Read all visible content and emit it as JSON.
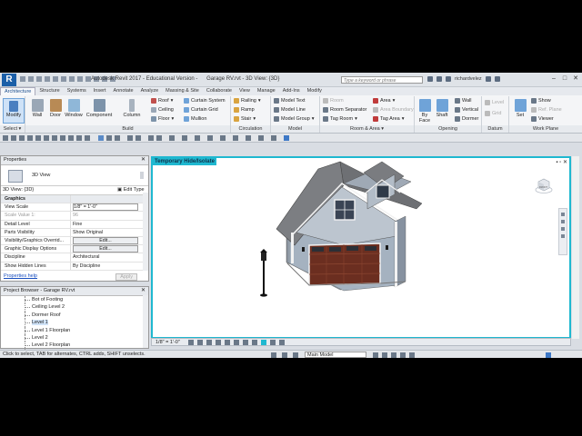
{
  "app": {
    "title_product": "Autodesk Revit 2017 - Educational Version -",
    "title_file": "Garage RV.rvt - 3D View: {3D}",
    "search_placeholder": "Type a keyword or phrase",
    "username": "richardvelez"
  },
  "tabs": [
    "Architecture",
    "Structure",
    "Systems",
    "Insert",
    "Annotate",
    "Analyze",
    "Massing & Site",
    "Collaborate",
    "View",
    "Manage",
    "Add-Ins",
    "Modify"
  ],
  "ribbon": {
    "select": {
      "modify": "Modify",
      "label": "Select ▾"
    },
    "build": {
      "label": "Build",
      "big": [
        "Wall",
        "Door",
        "Window",
        "Component",
        "Column"
      ],
      "col1": [
        "Roof",
        "Ceiling",
        "Floor"
      ],
      "col2": [
        "Curtain System",
        "Curtain Grid",
        "Mullion"
      ]
    },
    "circulation": {
      "label": "Circulation",
      "items": [
        "Railing",
        "Ramp",
        "Stair"
      ]
    },
    "model": {
      "label": "Model",
      "items": [
        "Model Text",
        "Model Line",
        "Model Group"
      ]
    },
    "room": {
      "label": "Room & Area ▾",
      "col1": [
        "Room",
        "Room Separator",
        "Tag Room"
      ],
      "col2": [
        "Area",
        "Area Boundary",
        "Tag Area"
      ]
    },
    "opening": {
      "label": "Opening",
      "big": [
        "By Face",
        "Shaft"
      ],
      "items": [
        "Wall",
        "Vertical",
        "Dormer"
      ]
    },
    "datum": {
      "label": "Datum",
      "items": [
        "Level",
        "Grid"
      ]
    },
    "workplane": {
      "label": "Work Plane",
      "set": "Set",
      "items": [
        "Show",
        "Ref. Plane",
        "Viewer"
      ]
    }
  },
  "properties": {
    "title": "Properties",
    "type_name": "3D View",
    "instance_selector": "3D View: {3D}",
    "edit_type": "Edit Type",
    "rows": [
      {
        "k": "Graphics",
        "v": "",
        "section": true
      },
      {
        "k": "View Scale",
        "v": "1/8\" = 1'-0\"",
        "box": true
      },
      {
        "k": "Scale Value    1:",
        "v": "96",
        "dim": true
      },
      {
        "k": "Detail Level",
        "v": "Fine"
      },
      {
        "k": "Parts Visibility",
        "v": "Show Original"
      },
      {
        "k": "Visibility/Graphics Overrid...",
        "v": "Edit...",
        "btn": true
      },
      {
        "k": "Graphic Display Options",
        "v": "Edit...",
        "btn": true
      },
      {
        "k": "Discipline",
        "v": "Architectural"
      },
      {
        "k": "Show Hidden Lines",
        "v": "By Discipline"
      }
    ],
    "help": "Properties help",
    "apply": "Apply"
  },
  "project_browser": {
    "title": "Project Browser - Garage RV.rvt",
    "items": [
      "Bot of Footing",
      "Ceiling Level 2",
      "Dormer Roof",
      "Level 1",
      "Level 1 Floorplan",
      "Level 2",
      "Level 2 Floorplan"
    ],
    "highlighted": "Level 1"
  },
  "viewport": {
    "temp_label": "Temporary Hide/Isolate",
    "cube_label": "FRONT"
  },
  "view_control_bar": {
    "scale": "1/8\" = 1'-0\""
  },
  "statusbar": {
    "message": "Click to select, TAB for alternates, CTRL adds, SHIFT unselects.",
    "model": "Main Model"
  },
  "colors": {
    "accent": "#1fb8d0",
    "revit_blue": "#1b5fa8"
  }
}
